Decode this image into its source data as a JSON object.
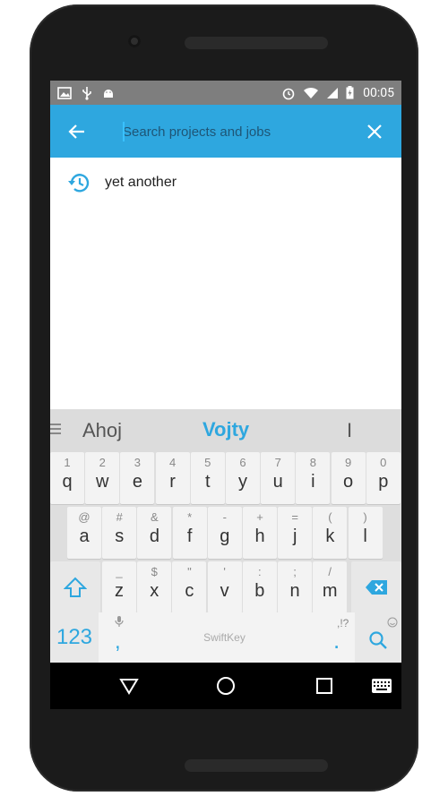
{
  "status_bar": {
    "time": "00:05"
  },
  "search": {
    "placeholder": "Search projects and jobs",
    "value": ""
  },
  "suggestions": [
    {
      "label": "yet another"
    }
  ],
  "keyboard": {
    "predictions": {
      "left": "Ahoj",
      "center": "Vojty",
      "right": "I"
    },
    "rows": [
      [
        [
          "1",
          "q"
        ],
        [
          "2",
          "w"
        ],
        [
          "3",
          "e"
        ],
        [
          "4",
          "r"
        ],
        [
          "5",
          "t"
        ],
        [
          "6",
          "y"
        ],
        [
          "7",
          "u"
        ],
        [
          "8",
          "i"
        ],
        [
          "9",
          "o"
        ],
        [
          "0",
          "p"
        ]
      ],
      [
        [
          "@",
          "a"
        ],
        [
          "#",
          "s"
        ],
        [
          "&",
          "d"
        ],
        [
          "*",
          "f"
        ],
        [
          "-",
          "g"
        ],
        [
          "+",
          "h"
        ],
        [
          "=",
          "j"
        ],
        [
          "(",
          "k"
        ],
        [
          ")",
          "l"
        ]
      ],
      [
        [
          "_",
          "z"
        ],
        [
          "$",
          "x"
        ],
        [
          "\"",
          "c"
        ],
        [
          "'",
          "v"
        ],
        [
          ":",
          "b"
        ],
        [
          ";",
          "n"
        ],
        [
          "/",
          "m"
        ]
      ]
    ],
    "num_label": "123",
    "comma": ",",
    "period": ".",
    "period_secondary": ",!?",
    "space_brand": "SwiftKey"
  },
  "colors": {
    "accent": "#2ea7df",
    "statusbar": "#7e7e7e"
  }
}
